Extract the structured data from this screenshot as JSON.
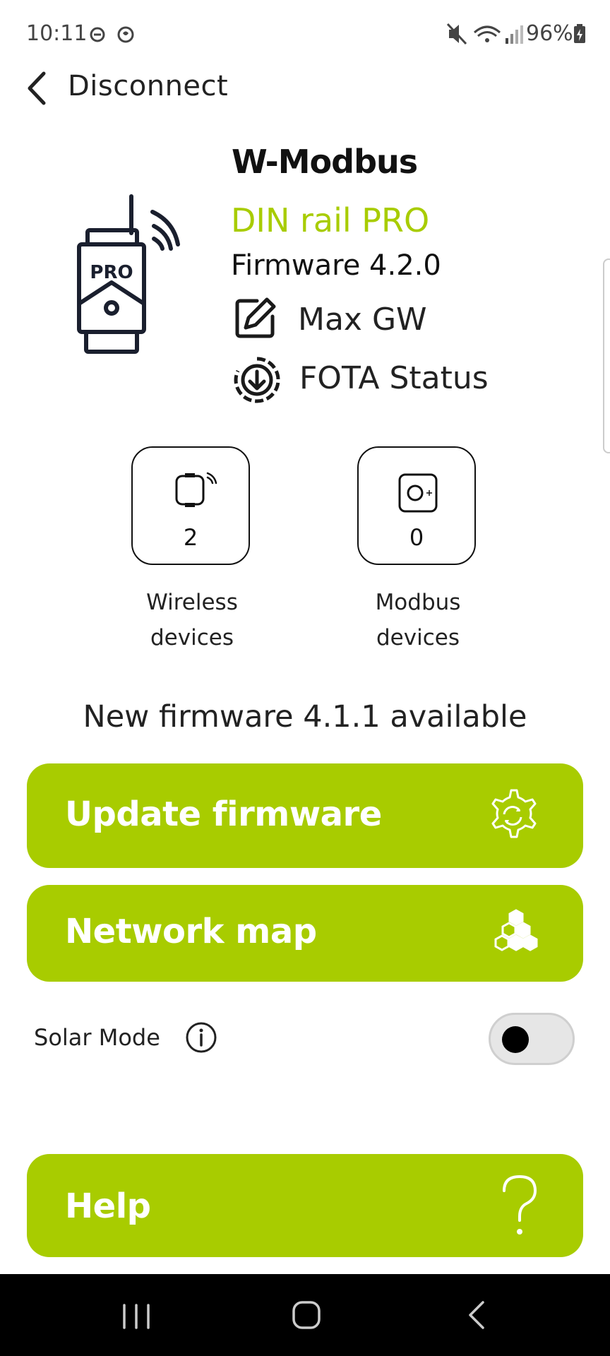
{
  "status_bar": {
    "time": "10:11",
    "battery_percent": "96%"
  },
  "top_bar": {
    "back_label": "Disconnect"
  },
  "device": {
    "brand": "W-Modbus",
    "model": "DIN rail PRO",
    "firmware": "Firmware 4.2.0",
    "name": "Max GW",
    "fota_label": "FOTA Status",
    "illustration_badge": "PRO"
  },
  "tiles": [
    {
      "count": "2",
      "caption_line1": "Wireless",
      "caption_line2": "devices"
    },
    {
      "count": "0",
      "caption_line1": "Modbus",
      "caption_line2": "devices"
    }
  ],
  "update_notice": "New firmware 4.1.1 available",
  "buttons": {
    "update_firmware": "Update firmware",
    "network_map": "Network map",
    "help": "Help"
  },
  "solar_mode": {
    "label": "Solar Mode",
    "enabled": false
  },
  "colors": {
    "accent": "#a8cc00",
    "text": "#111111",
    "nav_bar": "#000000"
  }
}
